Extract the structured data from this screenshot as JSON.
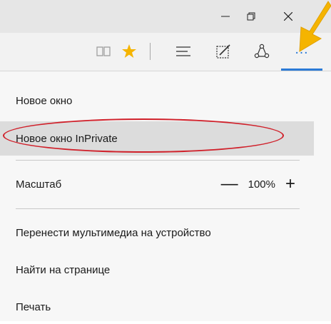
{
  "window": {
    "minimize_icon": "minimize-icon",
    "maximize_icon": "restore-icon",
    "close_icon": "close-icon"
  },
  "toolbar": {
    "icons": [
      "reading-view-icon",
      "favorites-star-icon",
      "hub-icon",
      "web-note-icon",
      "share-icon",
      "more-actions-icon"
    ],
    "more_label": "…",
    "accent_color": "#2b7ad6",
    "star_color": "#f5b400"
  },
  "menu": {
    "new_window": "Новое окно",
    "new_inprivate": "Новое окно InPrivate",
    "zoom_label": "Масштаб",
    "zoom_value": "100%",
    "zoom_minus": "—",
    "zoom_plus": "+",
    "cast_media": "Перенести мультимедиа на устройство",
    "find_on_page": "Найти на странице",
    "print": "Печать"
  },
  "annotation": {
    "highlight_color": "#d0202a",
    "arrow_color": "#f5b400"
  }
}
